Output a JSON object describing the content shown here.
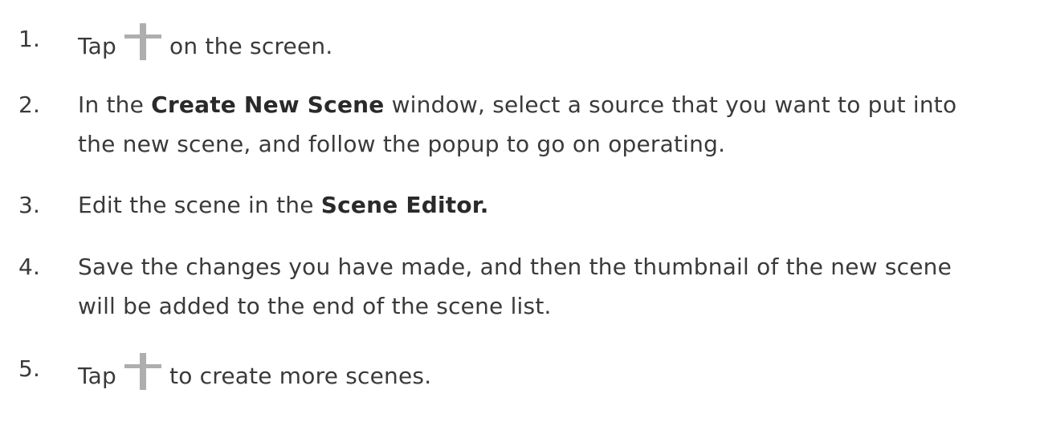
{
  "steps": [
    {
      "number": "1.",
      "before": "Tap",
      "icon": "plus-icon",
      "after": "on the screen."
    },
    {
      "number": "2.",
      "prefix": "In the",
      "bold": "Create New Scene",
      "suffix": "window, select a source that you want to put into",
      "line2": "the new scene, and follow the popup to go on operating."
    },
    {
      "number": "3.",
      "prefix": "Edit the scene in the",
      "bold": "Scene Editor."
    },
    {
      "number": "4.",
      "line1": "Save the changes you have made, and then the thumbnail of the new scene",
      "line2": "will be added to the end of the scene list."
    },
    {
      "number": "5.",
      "before": "Tap",
      "icon": "plus-icon",
      "after": "to create more scenes."
    }
  ]
}
